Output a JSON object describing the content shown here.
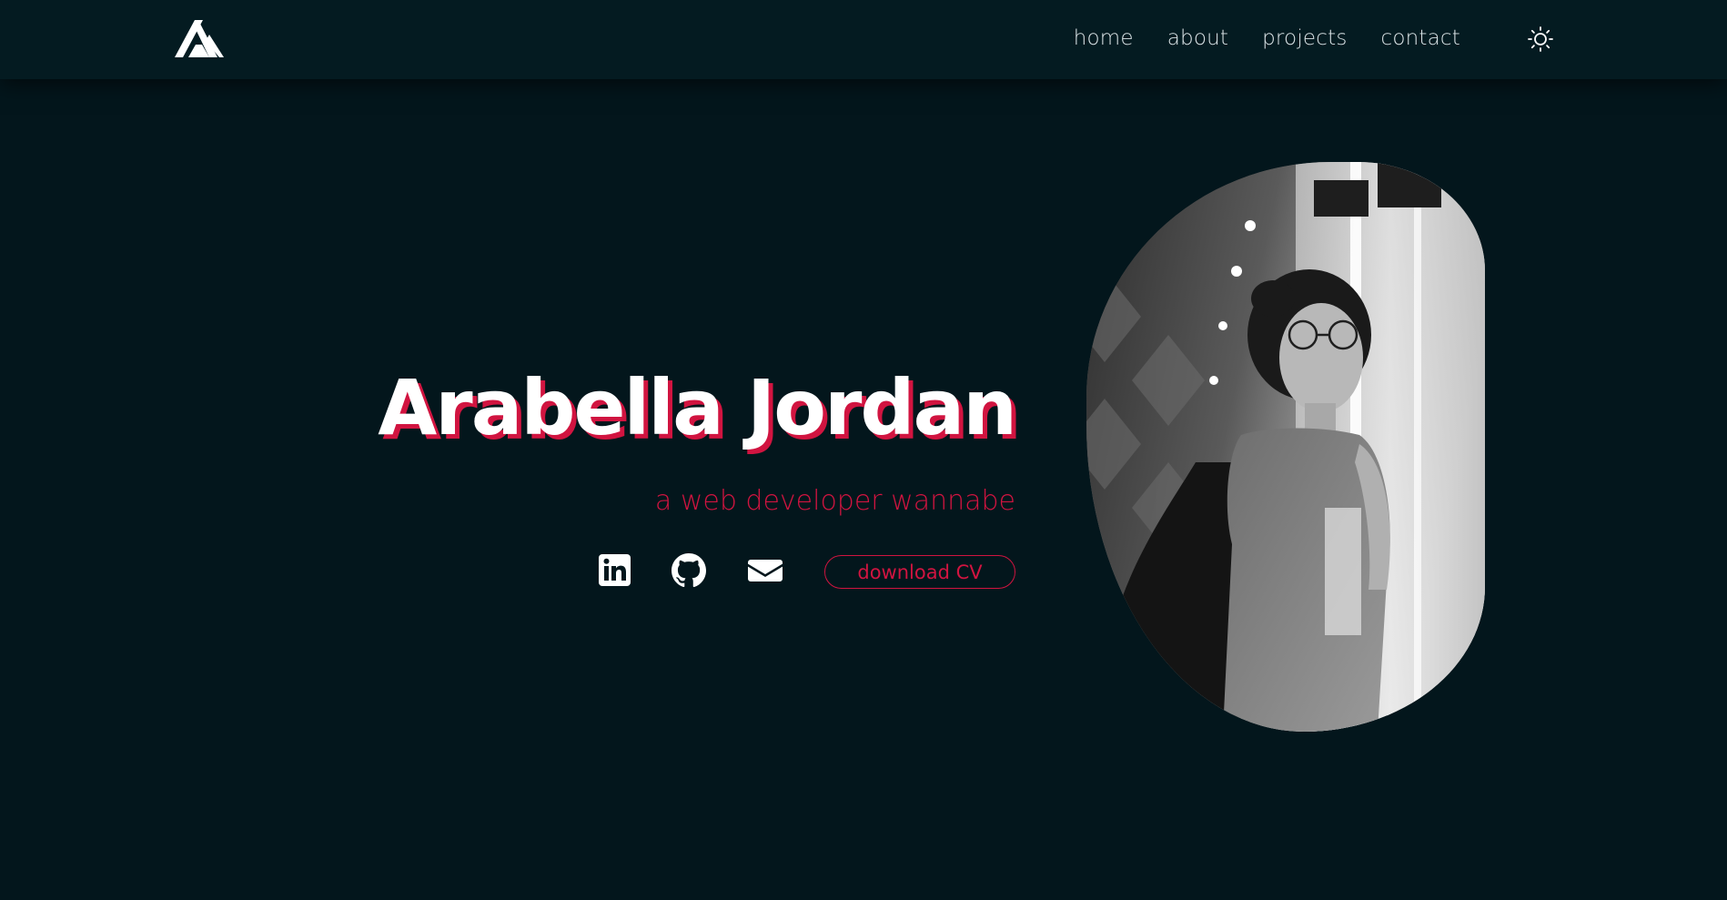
{
  "nav": {
    "links": [
      {
        "label": "home"
      },
      {
        "label": "about"
      },
      {
        "label": "projects"
      },
      {
        "label": "contact"
      }
    ],
    "logo_icon": "a-monogram-logo",
    "theme_icon": "sun-icon"
  },
  "hero": {
    "name": "Arabella Jordan",
    "tagline": "a web developer wannabe",
    "cv_button_label": "download CV",
    "socials": [
      {
        "icon": "linkedin-icon"
      },
      {
        "icon": "github-icon"
      },
      {
        "icon": "mail-icon"
      }
    ],
    "photo_icon": "profile-photo"
  },
  "colors": {
    "background": "#03161c",
    "navbar": "#041b21",
    "accent": "#d11440",
    "text": "#ffffff"
  }
}
